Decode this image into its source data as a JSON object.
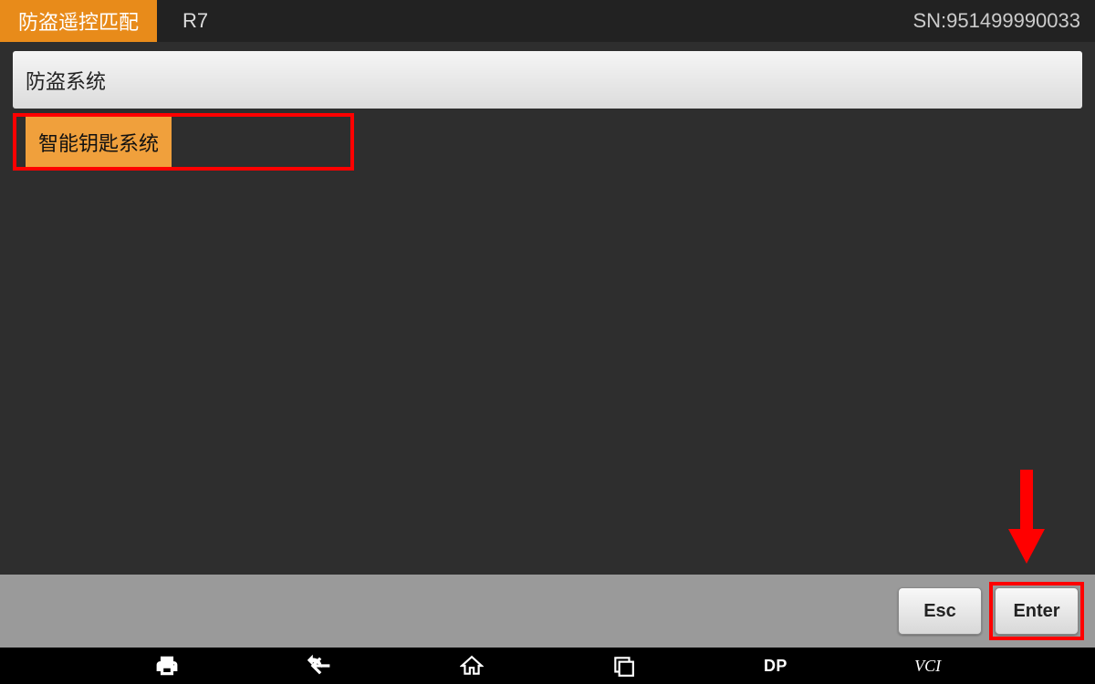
{
  "header": {
    "title": "防盗遥控匹配",
    "model": "R7",
    "sn_label": "SN:951499990033"
  },
  "menu": {
    "items": [
      {
        "label": "防盗系统",
        "selected": false
      },
      {
        "label": "智能钥匙系统",
        "selected": true
      }
    ]
  },
  "footer": {
    "esc_label": "Esc",
    "enter_label": "Enter"
  },
  "nav": {
    "dp_label": "DP",
    "vci_label": "VCI"
  },
  "colors": {
    "accent": "#e88b1a",
    "selected_bg": "#f0a03c",
    "highlight": "#ff0000"
  }
}
